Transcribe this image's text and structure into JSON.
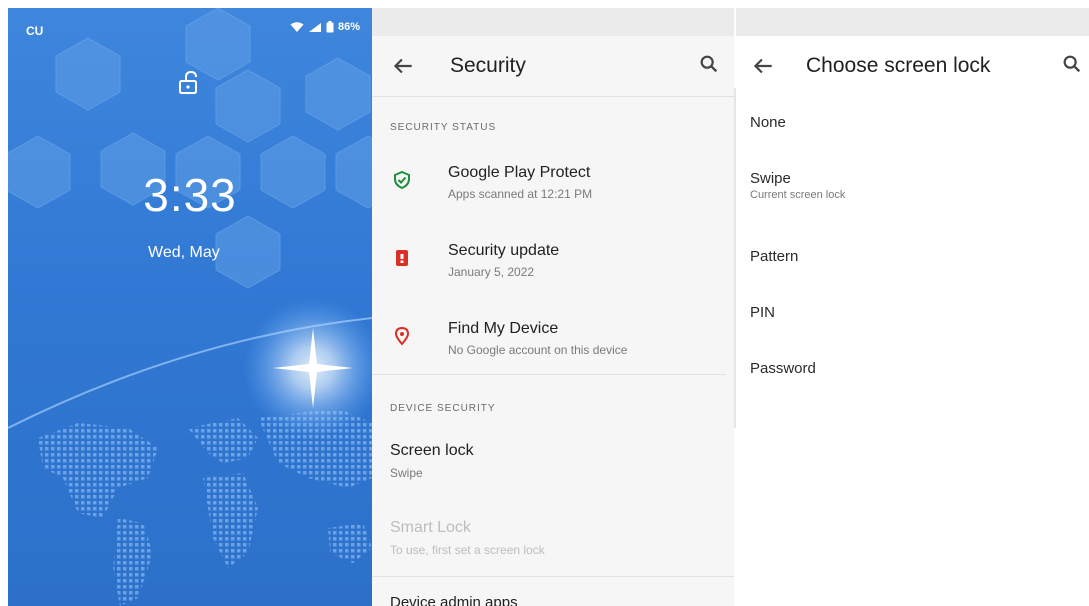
{
  "lock_screen": {
    "carrier": "CU",
    "battery": "86%",
    "time": "3:33",
    "date": "Wed, May"
  },
  "security": {
    "title": "Security",
    "section_status": "SECURITY STATUS",
    "items_status": [
      {
        "title": "Google Play Protect",
        "subtitle": "Apps scanned at 12:21 PM",
        "icon": "shield-check-icon",
        "color": "#1e8e3e"
      },
      {
        "title": "Security update",
        "subtitle": "January 5, 2022",
        "icon": "update-alert-icon",
        "color": "#d93025"
      },
      {
        "title": "Find My Device",
        "subtitle": "No Google account on this device",
        "icon": "location-pin-icon",
        "color": "#d93025"
      }
    ],
    "section_device": "DEVICE SECURITY",
    "screen_lock": {
      "title": "Screen lock",
      "subtitle": "Swipe"
    },
    "smart_lock": {
      "title": "Smart Lock",
      "subtitle": "To use, first set a screen lock"
    },
    "device_admin": {
      "title": "Device admin apps"
    }
  },
  "choose_lock": {
    "title": "Choose screen lock",
    "options": [
      {
        "title": "None",
        "subtitle": ""
      },
      {
        "title": "Swipe",
        "subtitle": "Current screen lock"
      },
      {
        "title": "Pattern",
        "subtitle": ""
      },
      {
        "title": "PIN",
        "subtitle": ""
      },
      {
        "title": "Password",
        "subtitle": ""
      }
    ]
  }
}
